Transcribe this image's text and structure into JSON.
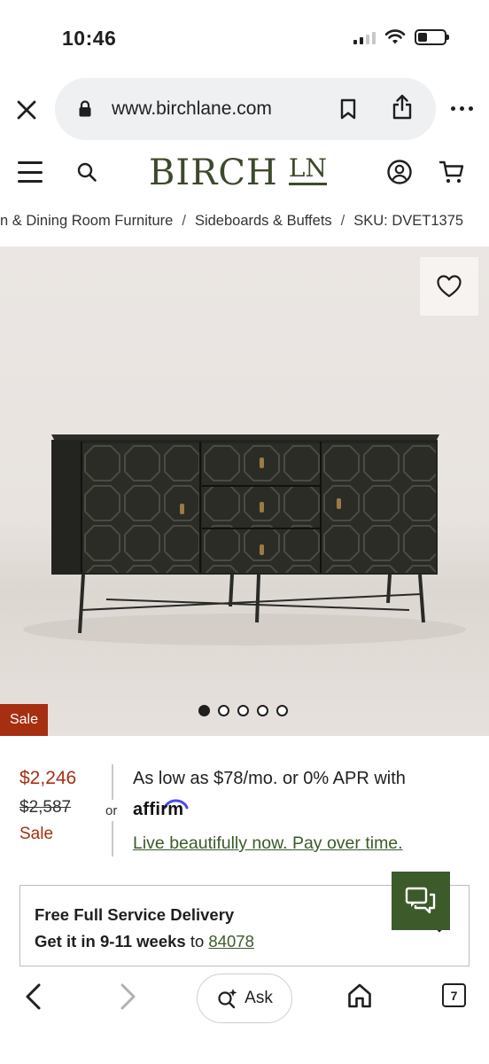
{
  "status_bar": {
    "time": "10:46"
  },
  "browser": {
    "url": "www.birchlane.com",
    "open_tabs_count": "7"
  },
  "site": {
    "logo_main": "BIRCH",
    "logo_ln": "LN",
    "brand_color": "#3c4a2b"
  },
  "breadcrumb": {
    "items": [
      "n & Dining Room Furniture",
      "Sideboards & Buffets",
      "SKU: DVET1375"
    ],
    "separator": "/"
  },
  "product_image": {
    "sale_tag": "Sale",
    "slide_count": 5,
    "active_slide": 1
  },
  "pricing": {
    "current_price": "$2,246",
    "original_price": "$2,587",
    "sale_label": "Sale",
    "or_text": "or",
    "finance_text": "As low as $78/mo. or 0% APR with",
    "affirm_text": "affirm",
    "finance_link": "Live beautifully now. Pay over time.",
    "sale_color": "#a62f12"
  },
  "delivery": {
    "title": "Free Full Service Delivery",
    "eta_prefix": "Get it in 9-11 weeks",
    "eta_to": "to",
    "zip": "84078"
  },
  "toolbar": {
    "ask_label": "Ask"
  },
  "icons": {
    "close": "close-icon",
    "lock": "lock-icon",
    "bookmark": "bookmark-icon",
    "share": "share-icon",
    "more": "more-icon",
    "menu": "hamburger-icon",
    "search": "search-icon",
    "account": "account-icon",
    "cart": "cart-icon",
    "favorite": "heart-icon",
    "chat": "chat-icon",
    "back": "chevron-left-icon",
    "forward": "chevron-right-icon",
    "ask": "sparkle-search-icon",
    "home": "home-icon",
    "tabs": "tabs-icon"
  }
}
